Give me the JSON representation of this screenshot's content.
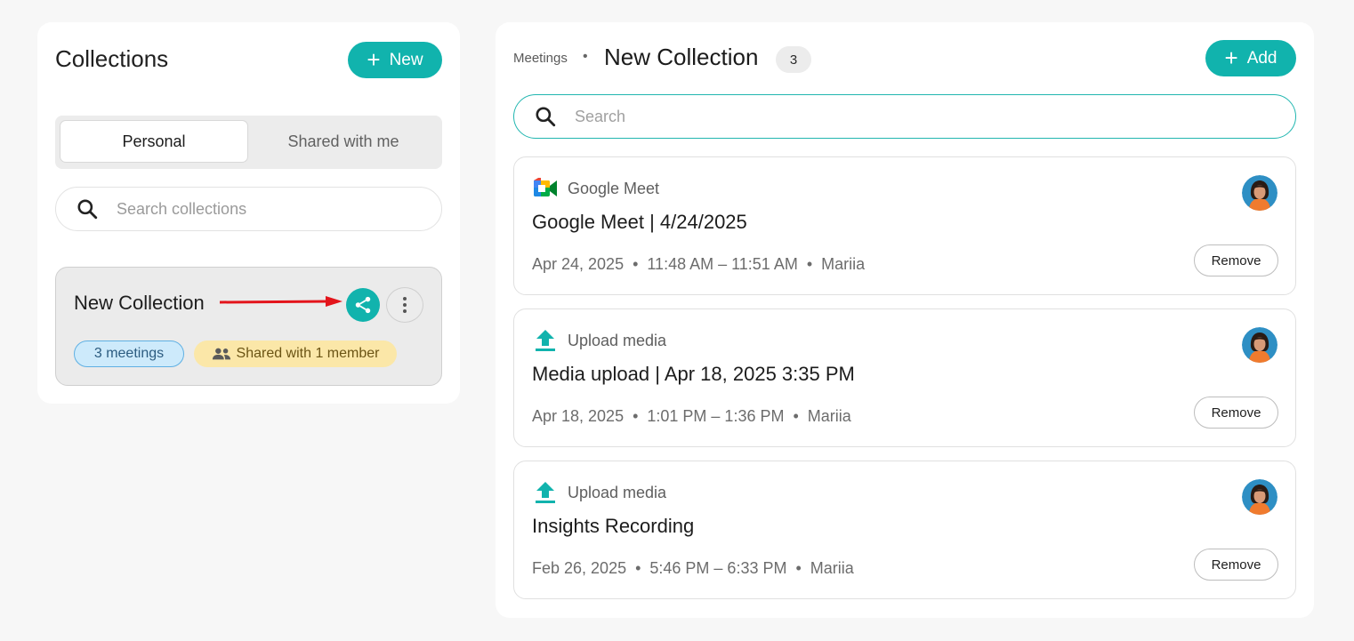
{
  "sidebar": {
    "title": "Collections",
    "new_button_label": "New",
    "tabs": [
      {
        "label": "Personal",
        "active": true
      },
      {
        "label": "Shared with me",
        "active": false
      }
    ],
    "search_placeholder": "Search collections",
    "collection": {
      "name": "New Collection",
      "meetings_badge": "3 meetings",
      "shared_badge": "Shared with 1 member"
    }
  },
  "main": {
    "breadcrumb": "Meetings",
    "title": "New Collection",
    "count": "3",
    "add_button_label": "Add",
    "search_placeholder": "Search",
    "meetings": [
      {
        "source": "Google Meet",
        "source_icon": "google-meet-icon",
        "title": "Google Meet | 4/24/2025",
        "meta": "Apr 24, 2025  •  11:48 AM – 11:51 AM  •  Mariia",
        "remove_label": "Remove"
      },
      {
        "source": "Upload media",
        "source_icon": "upload-icon",
        "title": "Media upload | Apr 18, 2025 3:35 PM",
        "meta": "Apr 18, 2025  •  1:01 PM – 1:36 PM  •  Mariia",
        "remove_label": "Remove"
      },
      {
        "source": "Upload media",
        "source_icon": "upload-icon",
        "title": "Insights Recording",
        "meta": "Feb 26, 2025  •  5:46 PM – 6:33 PM  •  Mariia",
        "remove_label": "Remove"
      }
    ]
  },
  "colors": {
    "accent": "#11b3ad",
    "annotation_arrow": "#e3141b"
  }
}
